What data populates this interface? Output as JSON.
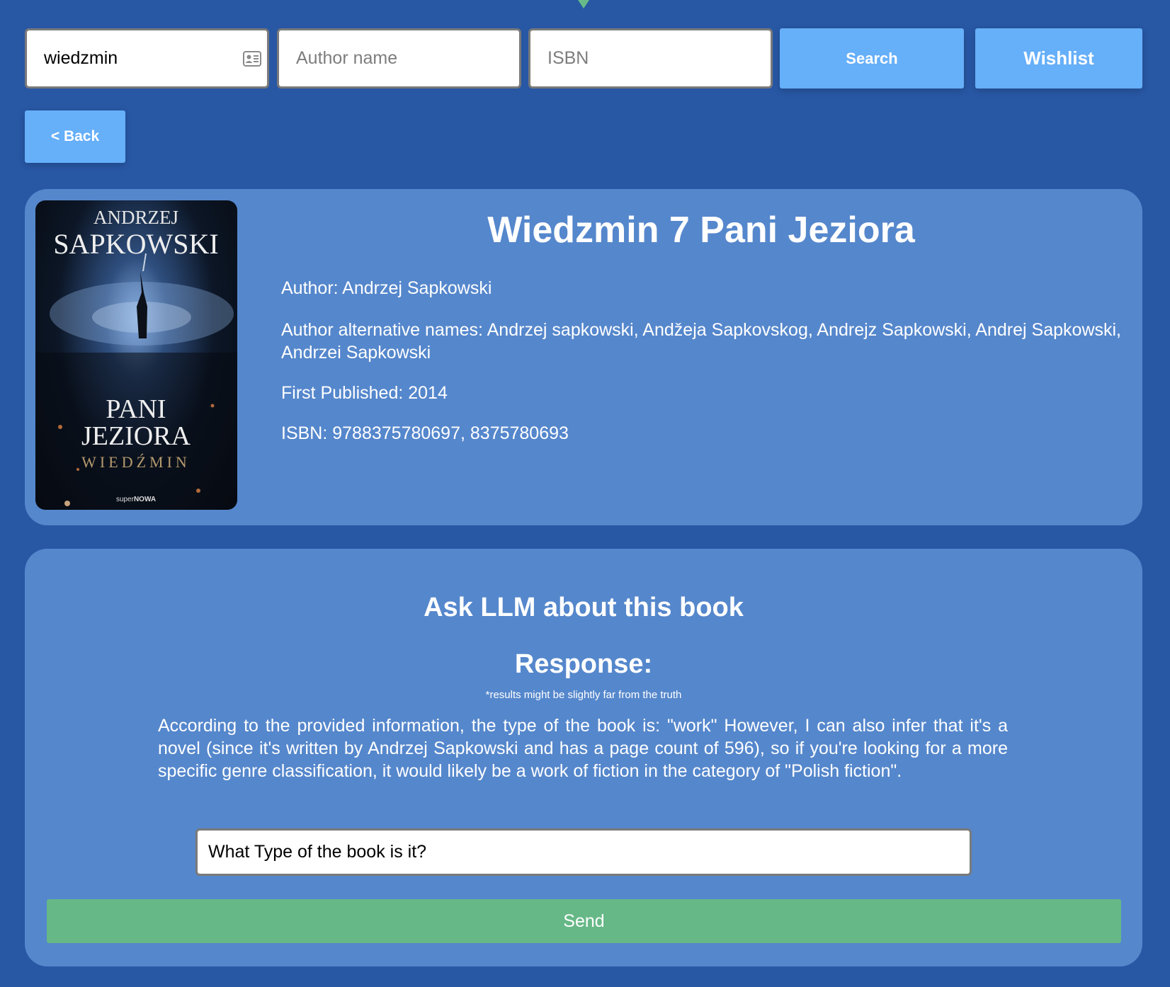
{
  "search": {
    "title_value": "wiedzmin",
    "author_placeholder": "Author name",
    "isbn_placeholder": "ISBN",
    "search_label": "Search",
    "wishlist_label": "Wishlist"
  },
  "nav": {
    "back_label": "< Back"
  },
  "book": {
    "title": "Wiedzmin 7 Pani Jeziora",
    "author_line": "Author: Andrzej Sapkowski",
    "alt_names_line": "Author alternative names: Andrzej sapkowski, Andžeja Sapkovskog, Andrejz Sapkowski, Andrej Sapkowski, Andrzei Sapkowski",
    "published_line": "First Published: 2014",
    "isbn_line": "ISBN: 9788375780697, 8375780693",
    "cover": {
      "author_first": "ANDRZEJ",
      "author_last": "SAPKOWSKI",
      "title_line1": "PANI",
      "title_line2": "JEZIORA",
      "series": "WIEDŹMIN",
      "publisher_prefix": "super",
      "publisher_suffix": "NOWA"
    }
  },
  "llm": {
    "heading": "Ask LLM about this book",
    "response_heading": "Response:",
    "disclaimer": "*results might be slightly far from the truth",
    "response_text": "According to the provided information, the type of the book is: \"work\" However, I can also infer that it's a novel (since it's written by Andrzej Sapkowski and has a page count of 596), so if you're looking for a more specific genre classification, it would likely be a work of fiction in the category of \"Polish fiction\".",
    "question_value": "What Type of the book is it?",
    "send_label": "Send"
  },
  "colors": {
    "page_background": "#2857a4",
    "card_background": "#5587cc",
    "primary_button": "#66aff9",
    "send_button": "#66b887",
    "text": "#ffffff"
  },
  "icons": {
    "title_field_icon": "contact-card-icon",
    "top_marker": "caret-down-icon"
  }
}
